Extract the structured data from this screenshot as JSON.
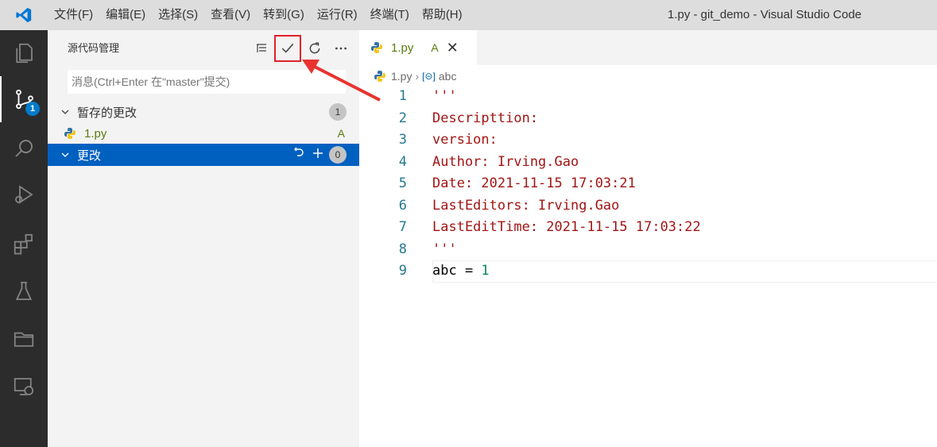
{
  "titlebar": {
    "menus": [
      "文件(F)",
      "编辑(E)",
      "选择(S)",
      "查看(V)",
      "转到(G)",
      "运行(R)",
      "终端(T)",
      "帮助(H)"
    ],
    "window_title": "1.py - git_demo - Visual Studio Code"
  },
  "activitybar": {
    "items": [
      "explorer-icon",
      "source-control-icon",
      "search-icon",
      "run-debug-icon",
      "extensions-icon",
      "testing-icon",
      "folder-icon",
      "remote-explorer-icon"
    ],
    "scm_badge": "1"
  },
  "sidebar": {
    "title": "源代码管理",
    "commit_placeholder": "消息(Ctrl+Enter 在\"master\"提交)",
    "staged": {
      "label": "暂存的更改",
      "count": "1",
      "files": [
        {
          "name": "1.py",
          "status": "A"
        }
      ]
    },
    "changes": {
      "label": "更改",
      "count": "0"
    }
  },
  "editor": {
    "tab": {
      "name": "1.py",
      "status": "A"
    },
    "breadcrumb": {
      "file": "1.py",
      "symbol": "abc"
    },
    "lines": [
      {
        "n": "1",
        "text": "'''"
      },
      {
        "n": "2",
        "text": "Descripttion:"
      },
      {
        "n": "3",
        "text": "version:"
      },
      {
        "n": "4",
        "text": "Author: Irving.Gao"
      },
      {
        "n": "5",
        "text": "Date: 2021-11-15 17:03:21"
      },
      {
        "n": "6",
        "text": "LastEditors: Irving.Gao"
      },
      {
        "n": "7",
        "text": "LastEditTime: 2021-11-15 17:03:22"
      },
      {
        "n": "8",
        "text": "'''"
      },
      {
        "n": "9",
        "text_var": "abc = ",
        "text_num": "1"
      }
    ]
  },
  "colors": {
    "accent": "#007acc",
    "selection": "#0060c0",
    "highlight_border": "#e0202a",
    "string": "#a31515",
    "line_number": "#237893"
  }
}
